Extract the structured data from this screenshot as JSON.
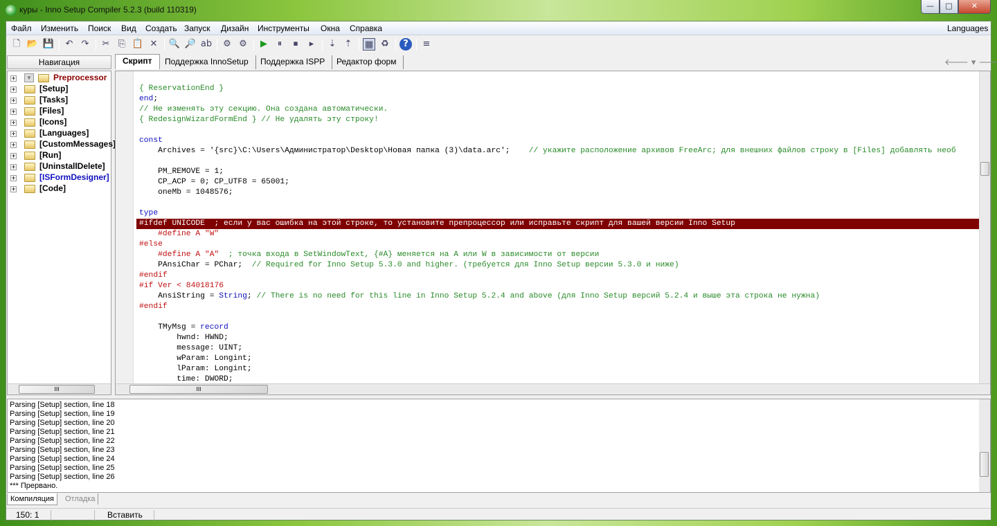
{
  "window": {
    "title": "куры - Inno Setup Compiler 5.2.3 (build 110319)",
    "minimize": "—",
    "maximize": "□",
    "close": "✕"
  },
  "menu": [
    "Файл",
    "Изменить",
    "Поиск",
    "Вид",
    "Создать",
    "Запуск",
    "Дизайн",
    "Инструменты",
    "Окна",
    "Справка"
  ],
  "menu_right": "Languages",
  "toolbar": [
    "new-file",
    "open-file",
    "save",
    "undo",
    "redo",
    "cut",
    "copy",
    "paste",
    "delete",
    "find",
    "find-next",
    "replace",
    "compile",
    "compile-options",
    "run",
    "pause",
    "stop",
    "step",
    "breakpoint",
    "trace",
    "form-designer",
    "recycle",
    "help",
    "wrap"
  ],
  "toolbar_glyphs": [
    "🗋",
    "📂",
    "💾",
    "↶",
    "↷",
    "✂",
    "⎘",
    "📋",
    "✕",
    "🔍",
    "🔎",
    "ab",
    "⚙",
    "⚙",
    "▶",
    "⏸",
    "⏹",
    "▸",
    "⇣",
    "⇡",
    "▦",
    "♻",
    "?",
    "≡"
  ],
  "nav": {
    "header": "Навигация",
    "items": [
      {
        "label": "Preprocessor",
        "color": "#8b0000"
      },
      {
        "label": "[Setup]",
        "color": "#000"
      },
      {
        "label": "[Tasks]",
        "color": "#000"
      },
      {
        "label": "[Files]",
        "color": "#000"
      },
      {
        "label": "[Icons]",
        "color": "#000"
      },
      {
        "label": "[Languages]",
        "color": "#000"
      },
      {
        "label": "[CustomMessages]",
        "color": "#000"
      },
      {
        "label": "[Run]",
        "color": "#000"
      },
      {
        "label": "[UninstallDelete]",
        "color": "#000"
      },
      {
        "label": "[ISFormDesigner]",
        "color": "#1010c0"
      },
      {
        "label": "[Code]",
        "color": "#000"
      }
    ]
  },
  "tabs": [
    "Скрипт",
    "Поддержка InnoSetup",
    "Поддержка ISPP",
    "Редактор форм"
  ],
  "nav_arrows": {
    "back": "🡐",
    "fwd": "🡒",
    "drop": "▾"
  },
  "code": [
    [
      [
        "cm",
        "{ ReservationEnd }"
      ]
    ],
    [
      [
        "kw",
        "end"
      ],
      [
        "tx",
        ";"
      ]
    ],
    [
      [
        "cm",
        "// Не изменять эту секцию. Она создана автоматически."
      ]
    ],
    [
      [
        "cm",
        "{ RedesignWizardFormEnd } // Не удалять эту строку!"
      ]
    ],
    [],
    [
      [
        "kw",
        "const"
      ]
    ],
    [
      [
        "tx",
        "    Archives = '{src}\\C:\\Users\\Администратор\\Desktop\\Новая папка (3)\\data.arc';    "
      ],
      [
        "cm",
        "// укажите расположение архивов FreeArc; для внешних файлов строку в [Files] добавлять необ"
      ]
    ],
    [],
    [
      [
        "tx",
        "    PM_REMOVE = 1;"
      ]
    ],
    [
      [
        "tx",
        "    CP_ACP = 0; CP_UTF8 = 65001;"
      ]
    ],
    [
      [
        "tx",
        "    oneMb = 1048576;"
      ]
    ],
    [],
    [
      [
        "kw",
        "type"
      ]
    ],
    [
      [
        "hl",
        "#ifdef UNICODE  ; если у вас ошибка на этой строке, то установите препроцессор или исправьте скрипт для вашей версии Inno Setup"
      ]
    ],
    [
      [
        "pp",
        "    #define A \"W\""
      ]
    ],
    [
      [
        "pp",
        "#else"
      ]
    ],
    [
      [
        "pp",
        "    #define A \"A\""
      ],
      [
        "cm",
        "  ; точка входа в SetWindowText, {#A} меняется на A или W в зависимости от версии"
      ]
    ],
    [
      [
        "tx",
        "    PAnsiChar = PChar;  "
      ],
      [
        "cm",
        "// Required for Inno Setup 5.3.0 and higher. (требуется для Inno Setup версии 5.3.0 и ниже)"
      ]
    ],
    [
      [
        "pp",
        "#endif"
      ]
    ],
    [
      [
        "pp",
        "#if Ver < 84018176"
      ]
    ],
    [
      [
        "tx",
        "    AnsiString = "
      ],
      [
        "kw",
        "String"
      ],
      [
        "tx",
        "; "
      ],
      [
        "cm",
        "// There is no need for this line in Inno Setup 5.2.4 and above (для Inno Setup версий 5.2.4 и выше эта строка не нужна)"
      ]
    ],
    [
      [
        "pp",
        "#endif"
      ]
    ],
    [],
    [
      [
        "tx",
        "    TMyMsg = "
      ],
      [
        "kw",
        "record"
      ]
    ],
    [
      [
        "tx",
        "        hwnd: HWND;"
      ]
    ],
    [
      [
        "tx",
        "        message: UINT;"
      ]
    ],
    [
      [
        "tx",
        "        wParam: Longint;"
      ]
    ],
    [
      [
        "tx",
        "        lParam: Longint;"
      ]
    ],
    [
      [
        "tx",
        "        time: DWORD;"
      ]
    ]
  ],
  "output": [
    "Parsing [Setup] section, line 18",
    "Parsing [Setup] section, line 19",
    "Parsing [Setup] section, line 20",
    "Parsing [Setup] section, line 21",
    "Parsing [Setup] section, line 22",
    "Parsing [Setup] section, line 23",
    "Parsing [Setup] section, line 24",
    "Parsing [Setup] section, line 25",
    "Parsing [Setup] section, line 26",
    "*** Прервано."
  ],
  "bottom_tabs": [
    "Компиляция",
    "Отладка"
  ],
  "status": {
    "position": "150:  1",
    "mode": "Вставить"
  },
  "scroll_grip": "III"
}
